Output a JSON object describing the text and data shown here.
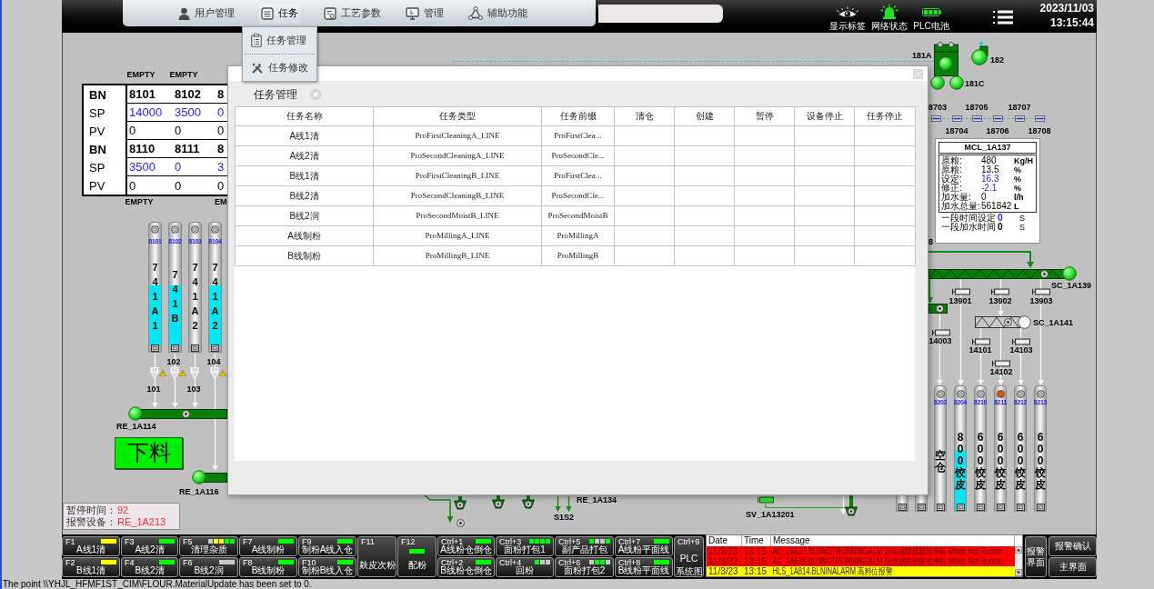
{
  "header": {
    "menu": [
      {
        "label": "用户管理",
        "expanded": false
      },
      {
        "label": "任务",
        "expanded": true,
        "submenu": [
          {
            "label": "任务管理"
          },
          {
            "label": "任务修改"
          }
        ]
      },
      {
        "label": "工艺参数",
        "expanded": false
      },
      {
        "label": "管理",
        "expanded": false
      },
      {
        "label": "辅助功能",
        "expanded": false
      }
    ],
    "indicators": [
      {
        "label": "显示标签"
      },
      {
        "label": "网络状态"
      },
      {
        "label": "PLC电池"
      }
    ],
    "date": "2023/11/03",
    "time": "13:15:44"
  },
  "dialog": {
    "tab": "任务管理",
    "table": {
      "columns": [
        "任务名称",
        "任务类型",
        "任务前缀",
        "清仓",
        "创建",
        "暂停",
        "设备停止",
        "任务停止"
      ],
      "rows": [
        [
          "A线1清",
          "ProFirstCleaningA_LINE",
          "ProFirstClea..."
        ],
        [
          "A线2清",
          "ProSecondCleaningA_LINE",
          "ProSecondCle..."
        ],
        [
          "B线1清",
          "ProFirstCleaningB_LINE",
          "ProFirstClea..."
        ],
        [
          "B线2清",
          "ProSecondCleaningB_LINE",
          "ProSecondCle..."
        ],
        [
          "B线2润",
          "ProSecondMoistB_LINE",
          "ProSecondMoistB"
        ],
        [
          "A线制粉",
          "ProMillingA_LINE",
          "ProMillingA"
        ],
        [
          "B线制粉",
          "ProMillingB_LINE",
          "ProMillingB"
        ]
      ]
    }
  },
  "left_area": {
    "top_labels": [
      "EMPTY",
      "EMPTY"
    ],
    "bin_table": [
      {
        "kind": "bn",
        "label": "BN",
        "values": [
          "8101",
          "8102",
          "8"
        ]
      },
      {
        "kind": "sp",
        "label": "SP",
        "values": [
          "14000",
          "3500",
          "0"
        ]
      },
      {
        "kind": "pv",
        "label": "PV",
        "values": [
          "0",
          "0",
          "0"
        ]
      },
      {
        "kind": "bn",
        "label": "BN",
        "values": [
          "8110",
          "8111",
          "8"
        ]
      },
      {
        "kind": "sp",
        "label": "SP",
        "values": [
          "3500",
          "0",
          "3"
        ]
      },
      {
        "kind": "pv",
        "label": "PV",
        "values": [
          "0",
          "0",
          "0"
        ]
      }
    ],
    "bottom_labels": [
      "EMPTY",
      "EM"
    ],
    "silos": [
      {
        "id": "8101",
        "label": "741A1",
        "filled": true,
        "alarm": false
      },
      {
        "id": "8102",
        "label": "741B",
        "filled": true,
        "alarm": false
      },
      {
        "id": "8103",
        "label": "741A2",
        "filled": false,
        "alarm": false
      },
      {
        "id": "8104",
        "label": "741A2",
        "filled": true,
        "alarm": false
      }
    ],
    "gates": [
      {
        "label": "101",
        "warning": true
      },
      {
        "label": "102",
        "warning": true
      },
      {
        "label": "103",
        "warning": false
      },
      {
        "label": "104",
        "warning": true
      }
    ],
    "conveyors": [
      {
        "label": "RE_1A114",
        "running": true
      },
      {
        "label": "RE_1A116",
        "running": true
      }
    ],
    "discharge_button": "下料",
    "status": [
      {
        "label": "暂停时间：",
        "value": "92"
      },
      {
        "label": "报警设备：",
        "value": "RE_1A213"
      }
    ]
  },
  "center_area": {
    "labels": [
      "RE_1A134",
      "S1S2",
      "SV_1A13201"
    ]
  },
  "right_area": {
    "equipment_labels": [
      "181A",
      "182",
      "181C"
    ],
    "sensors": [
      {
        "label": "8703"
      },
      {
        "label": "18704"
      },
      {
        "label": "18705"
      },
      {
        "label": "18706"
      },
      {
        "label": "18707"
      },
      {
        "label": "18708"
      }
    ],
    "mcl_panel": {
      "title": "MCL_1A137",
      "rows": [
        {
          "kind": "reading",
          "label": "原粮:",
          "value": "480",
          "unit": "Kg/H"
        },
        {
          "kind": "reading",
          "label": "原粮:",
          "value": "13.5",
          "unit": "%"
        },
        {
          "kind": "setpoint",
          "label": "设定:",
          "value": "16.3",
          "unit": "%"
        },
        {
          "kind": "setpoint",
          "label": "修正:",
          "value": "-2.1",
          "unit": "%"
        },
        {
          "kind": "reading",
          "label": "加水量:",
          "value": "0",
          "unit": "l/h"
        },
        {
          "kind": "reading",
          "label": "加水总量:",
          "value": "561842",
          "unit": "L"
        }
      ],
      "timers": [
        {
          "kind": "setpoint",
          "label": "一段时间设定",
          "value": "0",
          "unit": "S"
        },
        {
          "kind": "reading",
          "label": "一段加水时间",
          "value": "0",
          "unit": "S"
        }
      ]
    },
    "cut_label": "8",
    "conveyors": [
      {
        "label": "SC_1A139",
        "running": true
      },
      {
        "label": "SC_1A141",
        "running": false
      }
    ],
    "valves": [
      {
        "label": "13901"
      },
      {
        "label": "13902"
      },
      {
        "label": "13903"
      },
      {
        "label": "14003"
      },
      {
        "label": "14101"
      },
      {
        "label": "14103"
      },
      {
        "label": "14102"
      }
    ],
    "silos": [
      {
        "id": "8203",
        "label": "空仓",
        "filled": false,
        "alarm": false
      },
      {
        "id": "8204",
        "label": "800饺皮",
        "filled": true,
        "alarm": false
      },
      {
        "id": "8210",
        "label": "600饺皮",
        "filled": false,
        "alarm": false
      },
      {
        "id": "8211",
        "label": "600饺皮",
        "filled": false,
        "alarm": true
      },
      {
        "id": "8212",
        "label": "600饺皮",
        "filled": false,
        "alarm": false
      },
      {
        "id": "8213",
        "label": "600饺皮",
        "filled": false,
        "alarm": false
      }
    ]
  },
  "function_keys": [
    [
      {
        "key": "F1",
        "label": "A线1清",
        "lamps": [
          {
            "color": "#ffff00"
          }
        ]
      },
      {
        "key": "F2",
        "label": "B线1清",
        "lamps": [
          {
            "color": "#ffff00"
          }
        ]
      }
    ],
    [
      {
        "key": "F3",
        "label": "A线2清",
        "lamps": [
          {
            "color": "#00ff00"
          }
        ]
      },
      {
        "key": "F4",
        "label": "B线2清",
        "lamps": [
          {
            "color": "#00ff00"
          }
        ]
      }
    ],
    [
      {
        "key": "F5",
        "label": "清理杂质",
        "lamps": [
          {
            "color": "#c8c8c8"
          },
          {
            "color": "#ffff00"
          },
          {
            "color": "#ffff00"
          },
          {
            "color": "#00ff00"
          },
          {
            "color": "#00ff00"
          }
        ]
      },
      {
        "key": "F6",
        "label": "B线2润",
        "lamps": [
          {
            "color": "#c8c8c8"
          }
        ]
      }
    ],
    [
      {
        "key": "F7",
        "label": "A线制粉",
        "lamps": [
          {
            "color": "#00ff00"
          }
        ]
      },
      {
        "key": "F8",
        "label": "B线制粉",
        "lamps": [
          {
            "color": "#00ff00"
          }
        ]
      }
    ],
    [
      {
        "key": "F9",
        "label": "制粉A线入仓",
        "lamps": [
          {
            "color": "#00ff00"
          }
        ]
      },
      {
        "key": "F10",
        "label": "制粉B线入仓",
        "lamps": [
          {
            "color": "#00ff00"
          }
        ]
      }
    ],
    [
      {
        "key": "F11",
        "label": "麸皮次粉"
      }
    ],
    [
      {
        "key": "F12",
        "label": "配粉",
        "lamps": [
          {
            "color": "#00ff00"
          }
        ]
      }
    ],
    [
      {
        "key": "Ctrl+1",
        "label": "A线粉仓倒仓",
        "lamps": [
          {
            "color": "#00ff00"
          }
        ]
      },
      {
        "key": "Ctrl+2",
        "label": "B线粉仓倒仓",
        "lamps": [
          {
            "color": "#00ff00"
          }
        ]
      }
    ],
    [
      {
        "key": "Ctrl+3",
        "label": "面粉打包1",
        "lamps": [
          {
            "color": "#00ff00"
          },
          {
            "color": "#00ff00"
          },
          {
            "color": "#00ff00"
          },
          {
            "color": "#00ff00"
          }
        ]
      },
      {
        "key": "Ctrl+4",
        "label": "回粉",
        "lamps": [
          {
            "color": "#00ff00"
          },
          {
            "color": "#c8c8c8"
          },
          {
            "color": "#c8c8c8"
          }
        ]
      }
    ],
    [
      {
        "key": "Ctrl+5",
        "label": "副产品打包",
        "lamps": [
          {
            "color": "#00ff00"
          },
          {
            "color": "#c8c8c8"
          },
          {
            "color": "#c8c8c8"
          },
          {
            "color": "#00ff00"
          }
        ]
      },
      {
        "key": "Ctrl+6",
        "label": "面粉打包2",
        "lamps": [
          {
            "color": "#c8c8c8"
          },
          {
            "color": "#00ff00"
          },
          {
            "color": "#00ff00"
          },
          {
            "color": "#c8c8c8"
          }
        ]
      }
    ],
    [
      {
        "key": "Ctrl+7",
        "label": "A线粉平面线",
        "lamps": [
          {
            "color": "#00ff00"
          }
        ]
      },
      {
        "key": "Ctrl+8",
        "label": "B线粉平面线",
        "lamps": [
          {
            "color": "#00ff00"
          }
        ]
      }
    ],
    [
      {
        "key": "Ctrl+9",
        "label": "PLC 系统图"
      }
    ]
  ],
  "alarm_list": {
    "columns": [
      "Date",
      "Time",
      "Message"
    ],
    "rows": [
      {
        "color": "#ff0000",
        "cells": [
          "11/3/23",
          "13:15",
          "AC_1A517.BLNNOTRUNNINGALM 启动故障或就地停机 Motor Not Runnin"
        ]
      },
      {
        "color": "#ff0000",
        "cells": [
          "11/3/23",
          "13:15",
          "AC_1A518.BLNNOTRUNNINGALM 启动故障或就地停机 Motor Not Runnin"
        ]
      },
      {
        "color": "#ffff00",
        "cells": [
          "11/3/23",
          "13:15",
          "HLS_1A814.BLNINALARM 高料位报警"
        ]
      }
    ]
  },
  "alarm_buttons": [
    [
      {
        "label": "报警界面"
      }
    ],
    [
      {
        "label": "报警确认"
      },
      {
        "label": "主界面"
      }
    ]
  ],
  "status_bar": "The point \\\\YHJL_HFMF1ST_CIM\\FLOUR.MaterialUpdate has been set to 0."
}
